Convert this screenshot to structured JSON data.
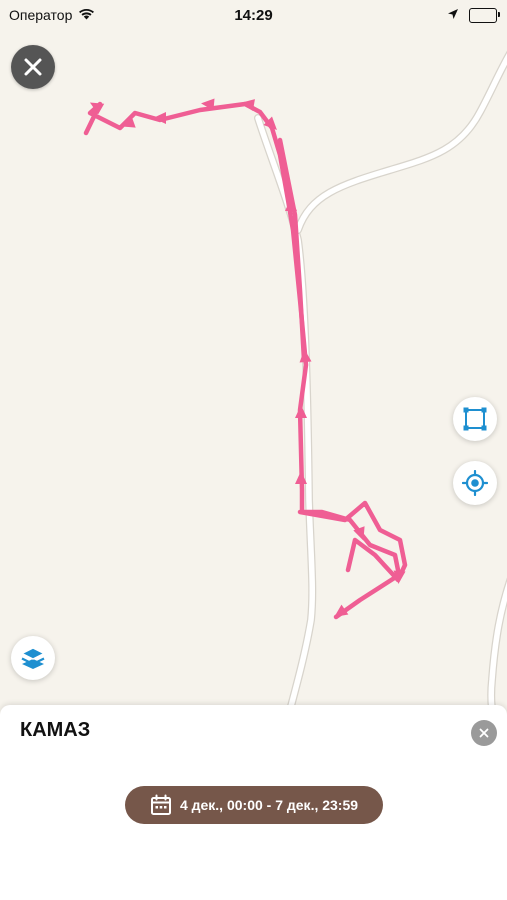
{
  "status_bar": {
    "carrier": "Оператор",
    "time": "14:29"
  },
  "map": {
    "track_color": "#ef5e94",
    "road_color": "#ffffff",
    "background_color": "#f6f3ec"
  },
  "controls": {
    "close_icon": "close-icon",
    "fit_bounds_icon": "fit-bounds-icon",
    "locate_icon": "locate-icon",
    "layers_icon": "layers-icon",
    "accent_color": "#1e8fd0"
  },
  "sheet": {
    "title": "КАМАЗ",
    "date_range": "4 дек., 00:00 - 7 дек., 23:59",
    "pill_color": "#76574a"
  }
}
